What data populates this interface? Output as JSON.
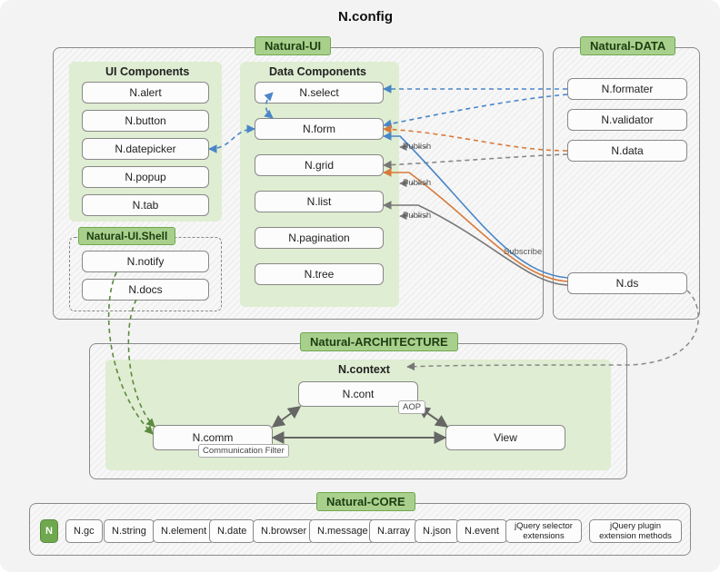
{
  "title": "N.config",
  "sections": {
    "natural_ui": {
      "tag": "Natural-UI"
    },
    "natural_data": {
      "tag": "Natural-DATA"
    },
    "natural_arch": {
      "tag": "Natural-ARCHITECTURE"
    },
    "natural_core": {
      "tag": "Natural-CORE"
    },
    "shell": {
      "tag": "Natural-UI.Shell"
    }
  },
  "ui_components": {
    "title": "UI Components",
    "items": [
      "N.alert",
      "N.button",
      "N.datepicker",
      "N.popup",
      "N.tab"
    ]
  },
  "data_components": {
    "title": "Data Components",
    "items": [
      "N.select",
      "N.form",
      "N.grid",
      "N.list",
      "N.pagination",
      "N.tree"
    ]
  },
  "shell_items": [
    "N.notify",
    "N.docs"
  ],
  "data_items": [
    "N.formater",
    "N.validator",
    "N.data",
    "N.ds"
  ],
  "arch": {
    "context": "N.context",
    "cont": "N.cont",
    "view": "View",
    "comm": "N.comm",
    "aop_chip": "AOP",
    "filter_chip": "Communication Filter"
  },
  "core": {
    "n": "N",
    "items": [
      "N.gc",
      "N.string",
      "N.element",
      "N.date",
      "N.browser",
      "N.message",
      "N.array",
      "N.json",
      "N.event"
    ],
    "ext1": "jQuery selector\nextensions",
    "ext2": "jQuery plugin\nextension methods"
  },
  "edge_labels": {
    "publish": "Publish",
    "subscribe": "Subscribe"
  }
}
